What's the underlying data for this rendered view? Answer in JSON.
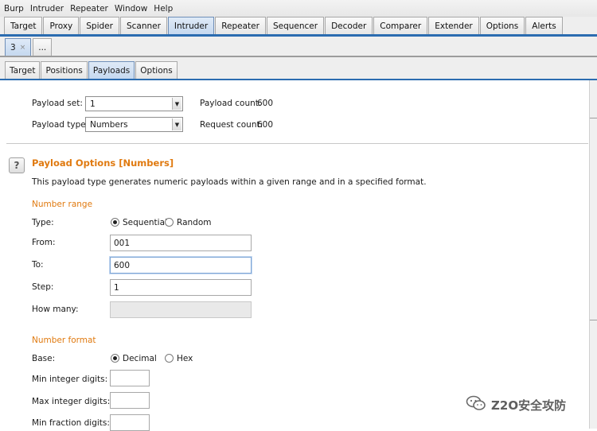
{
  "menu": [
    "Burp",
    "Intruder",
    "Repeater",
    "Window",
    "Help"
  ],
  "main_tabs": [
    {
      "label": "Target",
      "selected": false
    },
    {
      "label": "Proxy",
      "selected": false
    },
    {
      "label": "Spider",
      "selected": false
    },
    {
      "label": "Scanner",
      "selected": false
    },
    {
      "label": "Intruder",
      "selected": true
    },
    {
      "label": "Repeater",
      "selected": false
    },
    {
      "label": "Sequencer",
      "selected": false
    },
    {
      "label": "Decoder",
      "selected": false
    },
    {
      "label": "Comparer",
      "selected": false
    },
    {
      "label": "Extender",
      "selected": false
    },
    {
      "label": "Options",
      "selected": false
    },
    {
      "label": "Alerts",
      "selected": false
    }
  ],
  "attack_tabs": {
    "current": "3",
    "close": "×",
    "more": "..."
  },
  "sub_tabs": [
    {
      "label": "Target",
      "selected": false
    },
    {
      "label": "Positions",
      "selected": false
    },
    {
      "label": "Payloads",
      "selected": true
    },
    {
      "label": "Options",
      "selected": false
    }
  ],
  "payload_sets": {
    "set_label": "Payload set:",
    "set_value": "1",
    "type_label": "Payload type:",
    "type_value": "Numbers",
    "count_label": "Payload count:",
    "count_value": "600",
    "request_label": "Request count:",
    "request_value": "600"
  },
  "payload_options": {
    "help": "?",
    "title": "Payload Options [Numbers]",
    "description": "This payload type generates numeric payloads within a given range and in a specified format.",
    "number_range": {
      "heading": "Number range",
      "type_label": "Type:",
      "sequential_label": "Sequential",
      "random_label": "Random",
      "selected": "Sequential",
      "from_label": "From:",
      "from_value": "001",
      "to_label": "To:",
      "to_value": "600",
      "step_label": "Step:",
      "step_value": "1",
      "how_many_label": "How many:",
      "how_many_value": ""
    },
    "number_format": {
      "heading": "Number format",
      "base_label": "Base:",
      "decimal_label": "Decimal",
      "hex_label": "Hex",
      "selected": "Decimal",
      "min_int_label": "Min integer digits:",
      "min_int_value": "",
      "max_int_label": "Max integer digits:",
      "max_int_value": "",
      "min_frac_label": "Min fraction digits:",
      "min_frac_value": ""
    }
  },
  "watermark": {
    "text": "Z2O安全攻防",
    "icon": "wechat-icon"
  },
  "colors": {
    "accent_orange": "#e07a10",
    "tab_underline": "#2b6cb0",
    "selected_tab": "#c5d8ef"
  }
}
